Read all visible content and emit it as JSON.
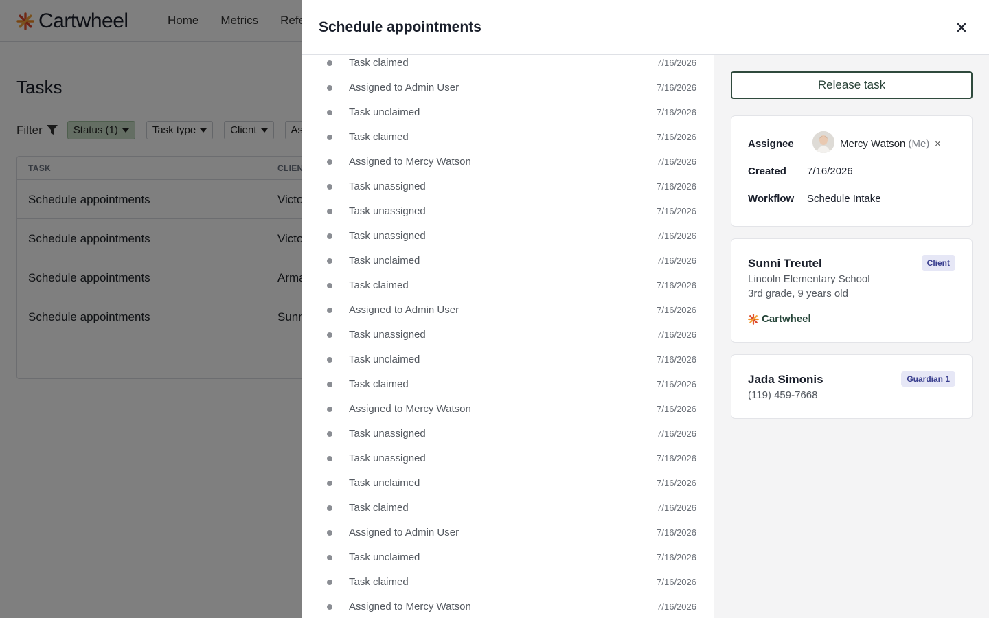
{
  "app": {
    "brand": "Cartwheel",
    "nav": [
      "Home",
      "Metrics",
      "Refe"
    ],
    "page_title": "Tasks",
    "filter_label": "Filter",
    "filters": [
      {
        "label": "Status (1)",
        "active": true
      },
      {
        "label": "Task type",
        "active": false
      },
      {
        "label": "Client",
        "active": false
      },
      {
        "label": "As",
        "active": false
      }
    ],
    "table": {
      "headers": [
        "TASK",
        "CLIENT"
      ],
      "rows": [
        {
          "task": "Schedule appointments",
          "client": "Victo"
        },
        {
          "task": "Schedule appointments",
          "client": "Victo"
        },
        {
          "task": "Schedule appointments",
          "client": "Arma"
        },
        {
          "task": "Schedule appointments",
          "client": "Sunn"
        }
      ]
    }
  },
  "drawer": {
    "title": "Schedule appointments",
    "history": [
      {
        "text": "Task claimed",
        "date": "7/16/2026"
      },
      {
        "text": "Assigned to Admin User",
        "date": "7/16/2026"
      },
      {
        "text": "Task unclaimed",
        "date": "7/16/2026"
      },
      {
        "text": "Task claimed",
        "date": "7/16/2026"
      },
      {
        "text": "Assigned to Mercy Watson",
        "date": "7/16/2026"
      },
      {
        "text": "Task unassigned",
        "date": "7/16/2026"
      },
      {
        "text": "Task unassigned",
        "date": "7/16/2026"
      },
      {
        "text": "Task unassigned",
        "date": "7/16/2026"
      },
      {
        "text": "Task unclaimed",
        "date": "7/16/2026"
      },
      {
        "text": "Task claimed",
        "date": "7/16/2026"
      },
      {
        "text": "Assigned to Admin User",
        "date": "7/16/2026"
      },
      {
        "text": "Task unassigned",
        "date": "7/16/2026"
      },
      {
        "text": "Task unclaimed",
        "date": "7/16/2026"
      },
      {
        "text": "Task claimed",
        "date": "7/16/2026"
      },
      {
        "text": "Assigned to Mercy Watson",
        "date": "7/16/2026"
      },
      {
        "text": "Task unassigned",
        "date": "7/16/2026"
      },
      {
        "text": "Task unassigned",
        "date": "7/16/2026"
      },
      {
        "text": "Task unclaimed",
        "date": "7/16/2026"
      },
      {
        "text": "Task claimed",
        "date": "7/16/2026"
      },
      {
        "text": "Assigned to Admin User",
        "date": "7/16/2026"
      },
      {
        "text": "Task unclaimed",
        "date": "7/16/2026"
      },
      {
        "text": "Task claimed",
        "date": "7/16/2026"
      },
      {
        "text": "Assigned to Mercy Watson",
        "date": "7/16/2026"
      }
    ],
    "release_label": "Release task",
    "details": {
      "assignee_label": "Assignee",
      "assignee_name": "Mercy Watson",
      "assignee_suffix": "(Me)",
      "remove_symbol": "×",
      "created_label": "Created",
      "created_value": "7/16/2026",
      "workflow_label": "Workflow",
      "workflow_value": "Schedule Intake"
    },
    "client": {
      "name": "Sunni Treutel",
      "badge": "Client",
      "school": "Lincoln Elementary School",
      "grade": "3rd grade, 9 years old",
      "brand": "Cartwheel"
    },
    "guardian": {
      "name": "Jada Simonis",
      "badge": "Guardian 1",
      "phone": "(119) 459-7668"
    }
  },
  "colors": {
    "overlay": "#00000080",
    "status_chip": "#c8ddc7",
    "release_border": "#2f4a3d",
    "badge_bg": "#e6e7f6",
    "brand_orange": "#e4572e",
    "side_panel": "#f4f4f5"
  }
}
